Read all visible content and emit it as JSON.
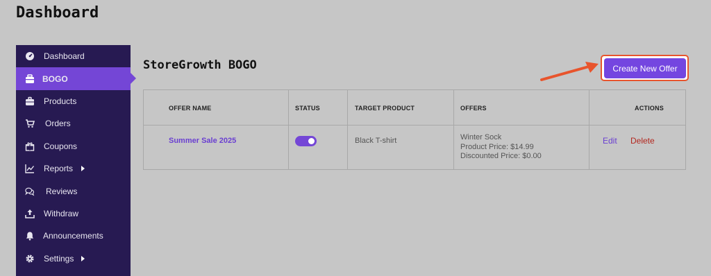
{
  "page": {
    "title": "Dashboard"
  },
  "sidebar": {
    "items": [
      {
        "label": "Dashboard",
        "icon": "speedometer-icon"
      },
      {
        "label": "BOGO",
        "icon": "gift-box-icon",
        "active": true
      },
      {
        "label": "Products",
        "icon": "briefcase-icon"
      },
      {
        "label": "Orders",
        "icon": "cart-icon"
      },
      {
        "label": "Coupons",
        "icon": "gift-icon"
      },
      {
        "label": "Reports",
        "icon": "chart-line-icon",
        "has_submenu": true
      },
      {
        "label": "Reviews",
        "icon": "comments-icon"
      },
      {
        "label": "Withdraw",
        "icon": "upload-icon"
      },
      {
        "label": "Announcements",
        "icon": "bell-icon"
      },
      {
        "label": "Settings",
        "icon": "gear-icon",
        "has_submenu": true
      }
    ]
  },
  "main": {
    "title": "StoreGrowth BOGO",
    "create_button_label": "Create New Offer",
    "table": {
      "headers": [
        "OFFER NAME",
        "STATUS",
        "TARGET PRODUCT",
        "OFFERS",
        "ACTIONS"
      ],
      "rows": [
        {
          "offer_name": "Summer Sale 2025",
          "status_enabled": true,
          "target_product": "Black T-shirt",
          "offer_lines": [
            "Winter Sock",
            "Product Price: $14.99",
            "Discounted Price: $0.00"
          ],
          "edit_label": "Edit",
          "delete_label": "Delete"
        }
      ]
    }
  },
  "colors": {
    "sidebar_bg": "#271a52",
    "accent": "#7446d6",
    "annotation_arrow": "#e8542c",
    "delete": "#b3261e"
  }
}
